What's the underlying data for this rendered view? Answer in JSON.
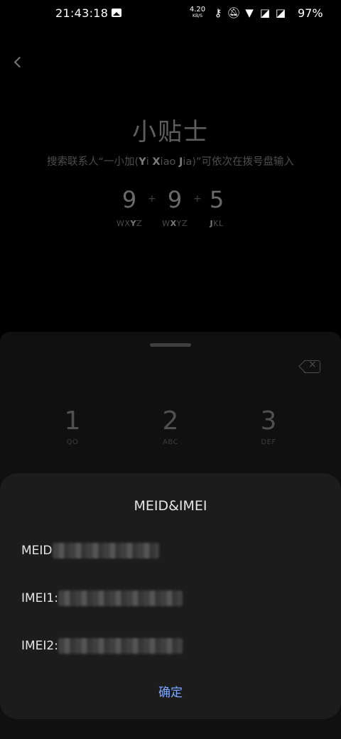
{
  "status_bar": {
    "time": "21:43:18",
    "net_speed_value": "4.20",
    "net_speed_unit": "KB/S",
    "battery": "97%",
    "icons": [
      "gallery-icon",
      "key-icon",
      "mute-bell-icon",
      "wifi-icon",
      "no-sim-icon",
      "no-sim-icon"
    ]
  },
  "tips": {
    "title": "小贴士",
    "desc_parts": [
      "搜索联系人“一小加(",
      "Y",
      "i ",
      "X",
      "iao ",
      "J",
      "ia)”可依次在拨号盘输入"
    ],
    "digits": [
      {
        "num": "9",
        "sub_pre": "WX",
        "sub_bold": "Y",
        "sub_post": "Z"
      },
      {
        "num": "9",
        "sub_pre": "W",
        "sub_bold": "X",
        "sub_post": "YZ"
      },
      {
        "num": "5",
        "sub_pre": "",
        "sub_bold": "J",
        "sub_post": "KL"
      }
    ],
    "separator": "+"
  },
  "dialpad": {
    "keys": [
      {
        "num": "1",
        "letters": "QO"
      },
      {
        "num": "2",
        "letters": "ABC"
      },
      {
        "num": "3",
        "letters": "DEF"
      }
    ]
  },
  "dialog": {
    "title": "MEID&IMEI",
    "rows": [
      {
        "label": "MEID"
      },
      {
        "label": "IMEI1:"
      },
      {
        "label": "IMEI2:"
      }
    ],
    "ok_label": "确定"
  },
  "colors": {
    "accent": "#7ea8ff",
    "dialog_bg": "#1c1c1c",
    "panel_bg": "#101010"
  }
}
